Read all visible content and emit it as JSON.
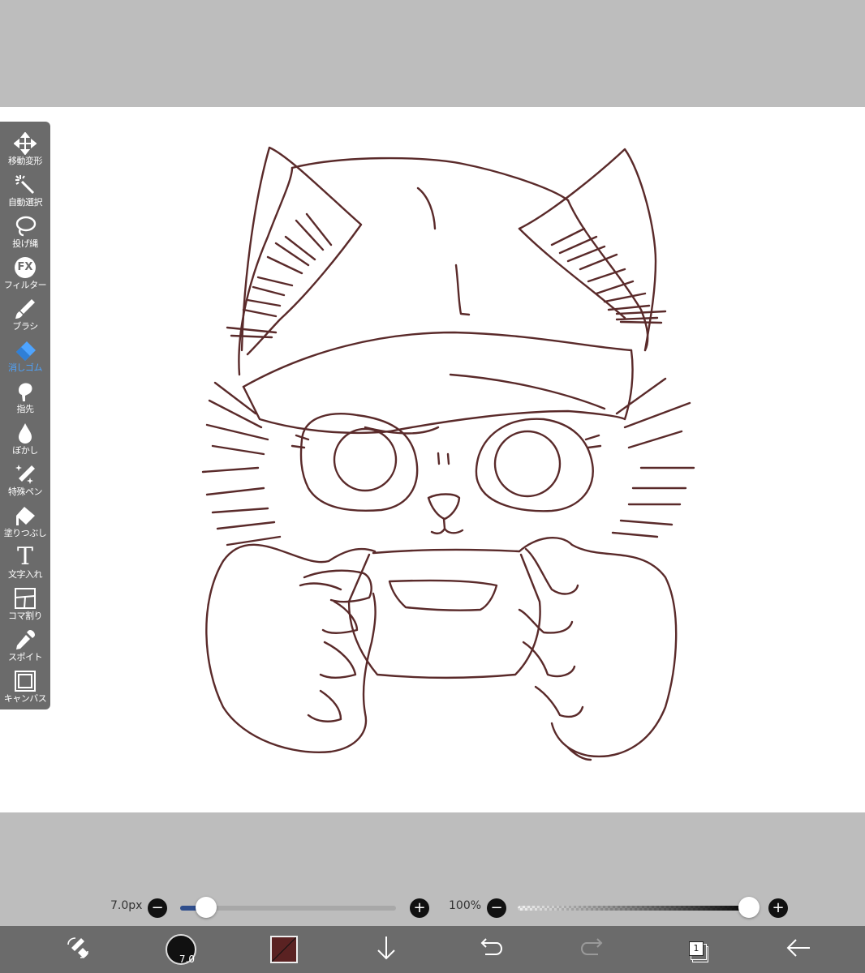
{
  "toolbar": {
    "items": [
      {
        "label": "移動変形",
        "icon": "move-icon"
      },
      {
        "label": "自動選択",
        "icon": "magic-wand-icon"
      },
      {
        "label": "投げ縄",
        "icon": "lasso-icon"
      },
      {
        "label": "フィルター",
        "icon": "fx-icon",
        "icon_text": "FX"
      },
      {
        "label": "ブラシ",
        "icon": "brush-icon"
      },
      {
        "label": "消しゴム",
        "icon": "eraser-icon",
        "active": true
      },
      {
        "label": "指先",
        "icon": "finger-icon"
      },
      {
        "label": "ぼかし",
        "icon": "blur-drop-icon"
      },
      {
        "label": "特殊ペン",
        "icon": "special-pen-icon"
      },
      {
        "label": "塗りつぶし",
        "icon": "fill-bucket-icon"
      },
      {
        "label": "文字入れ",
        "icon": "text-icon",
        "icon_text": "T"
      },
      {
        "label": "コマ割り",
        "icon": "frame-divider-icon"
      },
      {
        "label": "スポイト",
        "icon": "eyedropper-icon"
      },
      {
        "label": "キャンバス",
        "icon": "canvas-icon"
      }
    ],
    "active_color": "#4ea4ff"
  },
  "brush_size": {
    "value_label": "7.0px",
    "minus": "−",
    "plus": "+",
    "level": 0.12
  },
  "opacity": {
    "value_label": "100%",
    "minus": "−",
    "plus": "+",
    "level": 1.0
  },
  "bottom_bar": {
    "brush_preview_size": "7.0",
    "current_color": "#5a2222",
    "layer_count": "1"
  },
  "colors": {
    "stroke": "#5a2a2a",
    "toolbar_bg": "#6b6b6b",
    "workspace_bg": "#bdbdbd"
  }
}
